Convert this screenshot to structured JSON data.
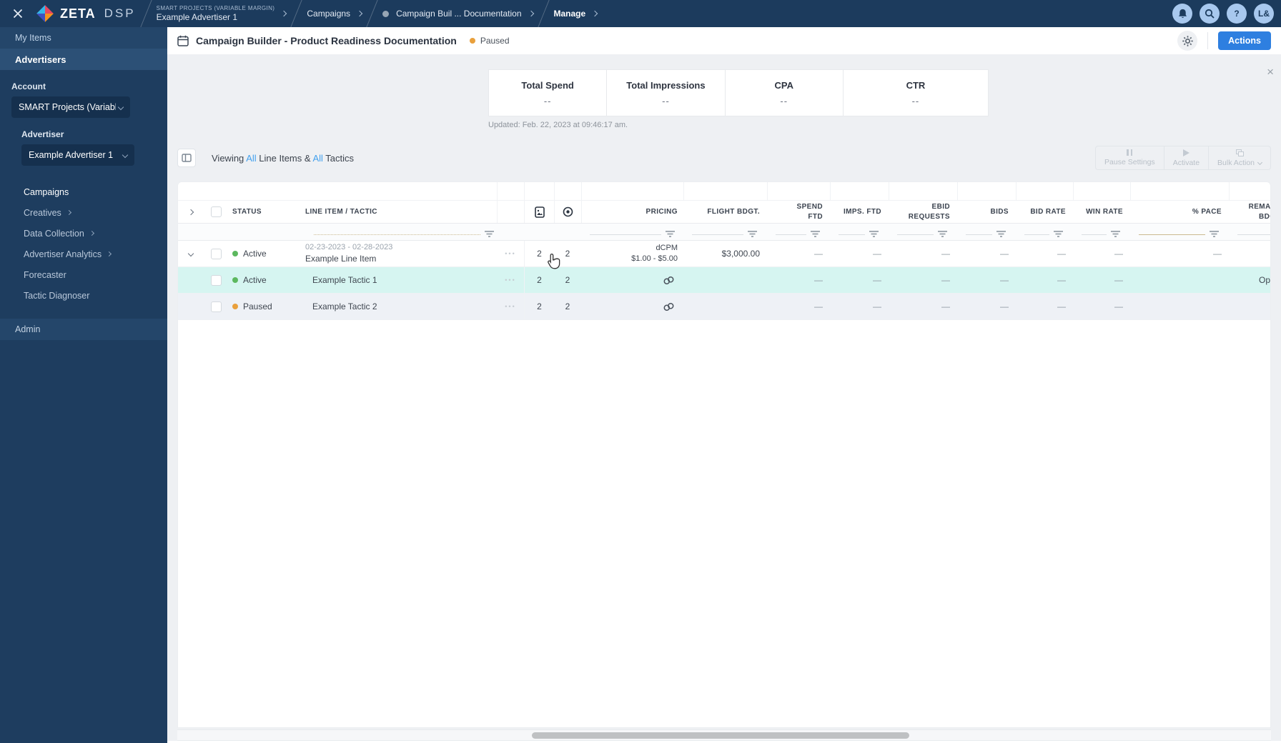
{
  "topbar": {
    "brand": "ZETA",
    "brand_suffix": "DSP",
    "crumb1_eyebrow": "SMART PROJECTS (VARIABLE MARGIN)",
    "crumb1_label": "Example Advertiser 1",
    "crumb2_label": "Campaigns",
    "crumb3_label": "Campaign Buil ... Documentation",
    "crumb4_label": "Manage",
    "help_label": "?",
    "avatar_initials": "L&"
  },
  "sidebar": {
    "my_items": "My Items",
    "advertisers": "Advertisers",
    "account_label": "Account",
    "account_value": "SMART Projects (Variable M...",
    "advertiser_label": "Advertiser",
    "advertiser_value": "Example Advertiser 1",
    "nav": [
      {
        "label": "Campaigns"
      },
      {
        "label": "Creatives"
      },
      {
        "label": "Data Collection"
      },
      {
        "label": "Advertiser Analytics"
      },
      {
        "label": "Forecaster"
      },
      {
        "label": "Tactic Diagnoser"
      }
    ],
    "admin": "Admin"
  },
  "page_header": {
    "title": "Campaign Builder - Product Readiness Documentation",
    "status": "Paused",
    "actions_label": "Actions"
  },
  "stats": {
    "cards": [
      {
        "label": "Total Spend",
        "value": "--"
      },
      {
        "label": "Total Impressions",
        "value": "--"
      },
      {
        "label": "CPA",
        "value": "--"
      },
      {
        "label": "CTR",
        "value": "--"
      }
    ],
    "updated": "Updated: Feb. 22, 2023 at 09:46:17 am."
  },
  "toolbar": {
    "viewing": {
      "p1": "Viewing",
      "all1": "All",
      "p2": "Line Items &",
      "all2": "All",
      "p3": "Tactics"
    },
    "pause_settings": "Pause Settings",
    "activate": "Activate",
    "bulk_action": "Bulk Action"
  },
  "table": {
    "headers": {
      "status": "STATUS",
      "line_item": "LINE ITEM / TACTIC",
      "pricing": "PRICING",
      "flight": "FLIGHT BDGT.",
      "spend_l1": "SPEND",
      "spend_l2": "FTD",
      "imps": "IMPS. FTD",
      "ebid_l1": "EBID",
      "ebid_l2": "REQUESTS",
      "bids": "BIDS",
      "bid_rate": "BID RATE",
      "win_rate": "WIN RATE",
      "pace": "% PACE",
      "remaining_l1": "REMAINING",
      "remaining_l2": "BDGT."
    },
    "rows": [
      {
        "status": "Active",
        "date_range": "02-23-2023 - 02-28-2023",
        "name": "Example Line Item",
        "menu": "•••",
        "creatives": "2",
        "targets": "2",
        "pricing_l1": "dCPM",
        "pricing_l2": "$1.00 - $5.00",
        "flight": "$3,000.00",
        "spend": "—",
        "imps": "—",
        "ebid": "—",
        "bids": "—",
        "bid_rate": "—",
        "win_rate": "—",
        "pace": "—",
        "remaining": ""
      },
      {
        "status": "Active",
        "name": "Example Tactic 1",
        "menu": "•••",
        "creatives": "2",
        "targets": "2",
        "spend": "—",
        "imps": "—",
        "ebid": "—",
        "bids": "—",
        "bid_rate": "—",
        "win_rate": "—",
        "pace": "",
        "remaining": "Optimized"
      },
      {
        "status": "Paused",
        "name": "Example Tactic 2",
        "menu": "•••",
        "creatives": "2",
        "targets": "2",
        "spend": "—",
        "imps": "—",
        "ebid": "—",
        "bids": "—",
        "bid_rate": "—",
        "win_rate": "—",
        "pace": "",
        "remaining": ""
      }
    ]
  },
  "colors": {
    "active_dot": "#5cb85f",
    "paused_dot": "#e9a03c",
    "accent_blue": "#2e7fe0",
    "link_blue": "#43a1ee",
    "selected_row": "#d6f5f1",
    "topbar_navy": "#1c3b5d"
  }
}
